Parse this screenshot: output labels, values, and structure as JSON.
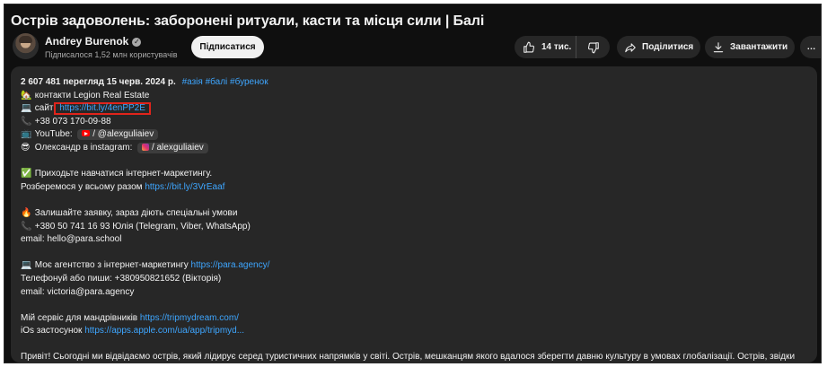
{
  "video": {
    "title": "Острів задоволень: заборонені ритуали, касти та місця сили | Балі"
  },
  "channel": {
    "name": "Andrey Burenok",
    "verified_glyph": "✓",
    "subscribers": "Підписалося 1,52 млн користувачів",
    "subscribe_label": "Підписатися"
  },
  "actions": {
    "likes": "14 тис.",
    "share": "Поділитися",
    "download": "Завантажити",
    "more": "…"
  },
  "description": {
    "views": "2 607 481 перегляд",
    "date": "15 черв. 2024 р.",
    "tags": "#азія #балі #буренок",
    "contacts": "контакти Legion Real Estate",
    "site_label": "сайт",
    "site_link": "https://bit.ly/4enPP2E",
    "phone1": "+38 073 170-09-88",
    "youtube_label": "YouTube:",
    "youtube_chip": "/ @alexguliaiev",
    "instagram_label": "Олександр в instagram:",
    "instagram_chip": "/ alexguliaiev",
    "course_line": "Приходьте навчатися інтернет-маркетингу.",
    "course_sub": "Розберемося у всьому разом",
    "course_link": "https://bit.ly/3VrEaaf",
    "apply_line": "Залишайте заявку, зараз діють спеціальні умови",
    "apply_phone": "+380 50 741 16 93 Юлія (Telegram, Viber, WhatsApp)",
    "apply_email": "email: hello@para.school",
    "agency_label": "Моє агентство з інтернет-маркетингу",
    "agency_link": "https://para.agency/",
    "agency_phone": "Телефонуй або пиши: +380950821652 (Вікторія)",
    "agency_email": "email: victoria@para.agency",
    "travel_label": "Мій сервіс для мандрівників",
    "travel_link": "https://tripmydream.com/",
    "ios_label": "iOs застосунок",
    "ios_link": "https://apps.apple.com/ua/app/tripmyd...",
    "intro": "Привіт! Сьогодні ми відвідаємо острів, який лідирує серед туристичних напрямків у світі. Острів, мешканцям якого вдалося зберегти давню культуру в умовах глобалізації. Острів, звідки люди повертаються щасливими. Наш випуск – про Балі."
  },
  "emoji": {
    "contacts": "🏡",
    "site": "💻",
    "phone": "📞",
    "youtube": "📺",
    "instagram": "😎",
    "check": "✅",
    "fire": "🔥",
    "agency": "💻"
  },
  "colors": {
    "background": "#0f0f0f",
    "panel": "#272727",
    "link": "#3ea6ff",
    "highlight_box": "#e0241b"
  }
}
